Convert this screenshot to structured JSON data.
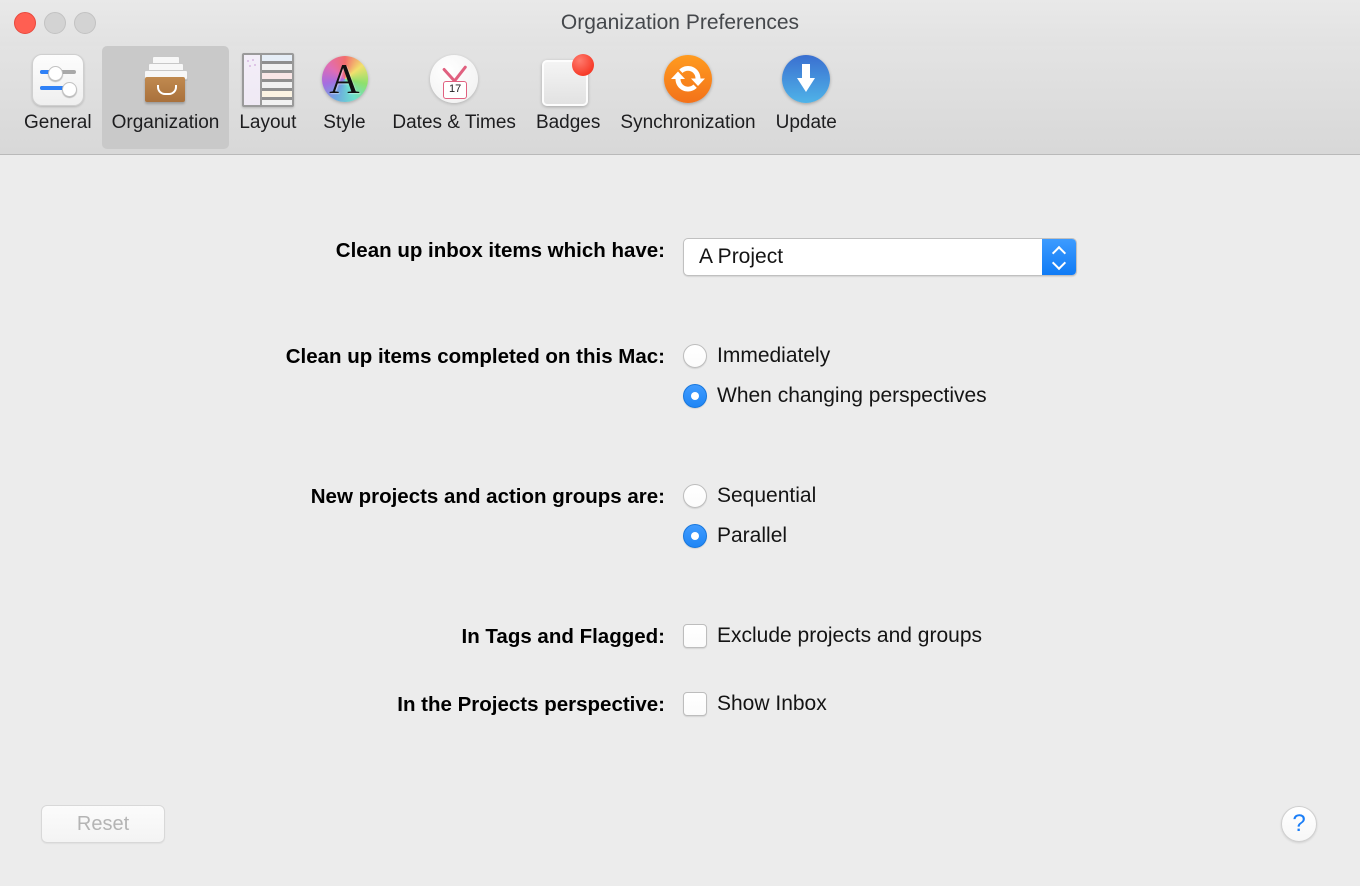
{
  "window": {
    "title": "Organization Preferences",
    "traffic_lights": [
      {
        "name": "close",
        "color": "#ff5f52",
        "enabled": true
      },
      {
        "name": "minimize",
        "color": "#d3d3d3",
        "enabled": false
      },
      {
        "name": "maximize",
        "color": "#d3d3d3",
        "enabled": false
      }
    ]
  },
  "toolbar": {
    "selected": "Organization",
    "items": [
      {
        "label": "General",
        "icon": "sliders-icon",
        "selected": false
      },
      {
        "label": "Organization",
        "icon": "file-drawer-icon",
        "selected": true
      },
      {
        "label": "Layout",
        "icon": "layout-icon",
        "selected": false
      },
      {
        "label": "Style",
        "icon": "font-color-wheel-icon",
        "selected": false,
        "glyph": "A"
      },
      {
        "label": "Dates & Times",
        "icon": "clock-calendar-icon",
        "selected": false,
        "badge": "17"
      },
      {
        "label": "Badges",
        "icon": "badge-dot-icon",
        "selected": false
      },
      {
        "label": "Synchronization",
        "icon": "sync-arrows-icon",
        "selected": false
      },
      {
        "label": "Update",
        "icon": "download-arrow-icon",
        "selected": false
      }
    ]
  },
  "form": {
    "rows": [
      {
        "label": "Clean up inbox items which have:",
        "control": "popup",
        "value": "A Project"
      },
      {
        "label": "Clean up items completed on this Mac:",
        "control": "radio-group",
        "options": [
          {
            "label": "Immediately",
            "selected": false
          },
          {
            "label": "When changing perspectives",
            "selected": true
          }
        ]
      },
      {
        "label": "New projects and action groups are:",
        "control": "radio-group",
        "options": [
          {
            "label": "Sequential",
            "selected": false
          },
          {
            "label": "Parallel",
            "selected": true
          }
        ]
      },
      {
        "label": "In Tags and Flagged:",
        "control": "checkbox",
        "options": [
          {
            "label": "Exclude projects and groups",
            "checked": false
          }
        ]
      },
      {
        "label": "In the Projects perspective:",
        "control": "checkbox",
        "options": [
          {
            "label": "Show Inbox",
            "checked": false
          }
        ]
      }
    ]
  },
  "footer": {
    "reset_label": "Reset",
    "reset_enabled": false,
    "help_label": "?"
  },
  "colors": {
    "accent_blue": "#1f86f5",
    "stepper_blue": "#0f7bf5",
    "help_blue": "#1b7ef7",
    "close_red": "#ff5f52",
    "badge_red": "#f73c2a",
    "sync_orange": "#f3721a",
    "drawer_brown": "#a9713c",
    "toolbar_selected": "#c9c9c9",
    "window_bg": "#ececec"
  }
}
